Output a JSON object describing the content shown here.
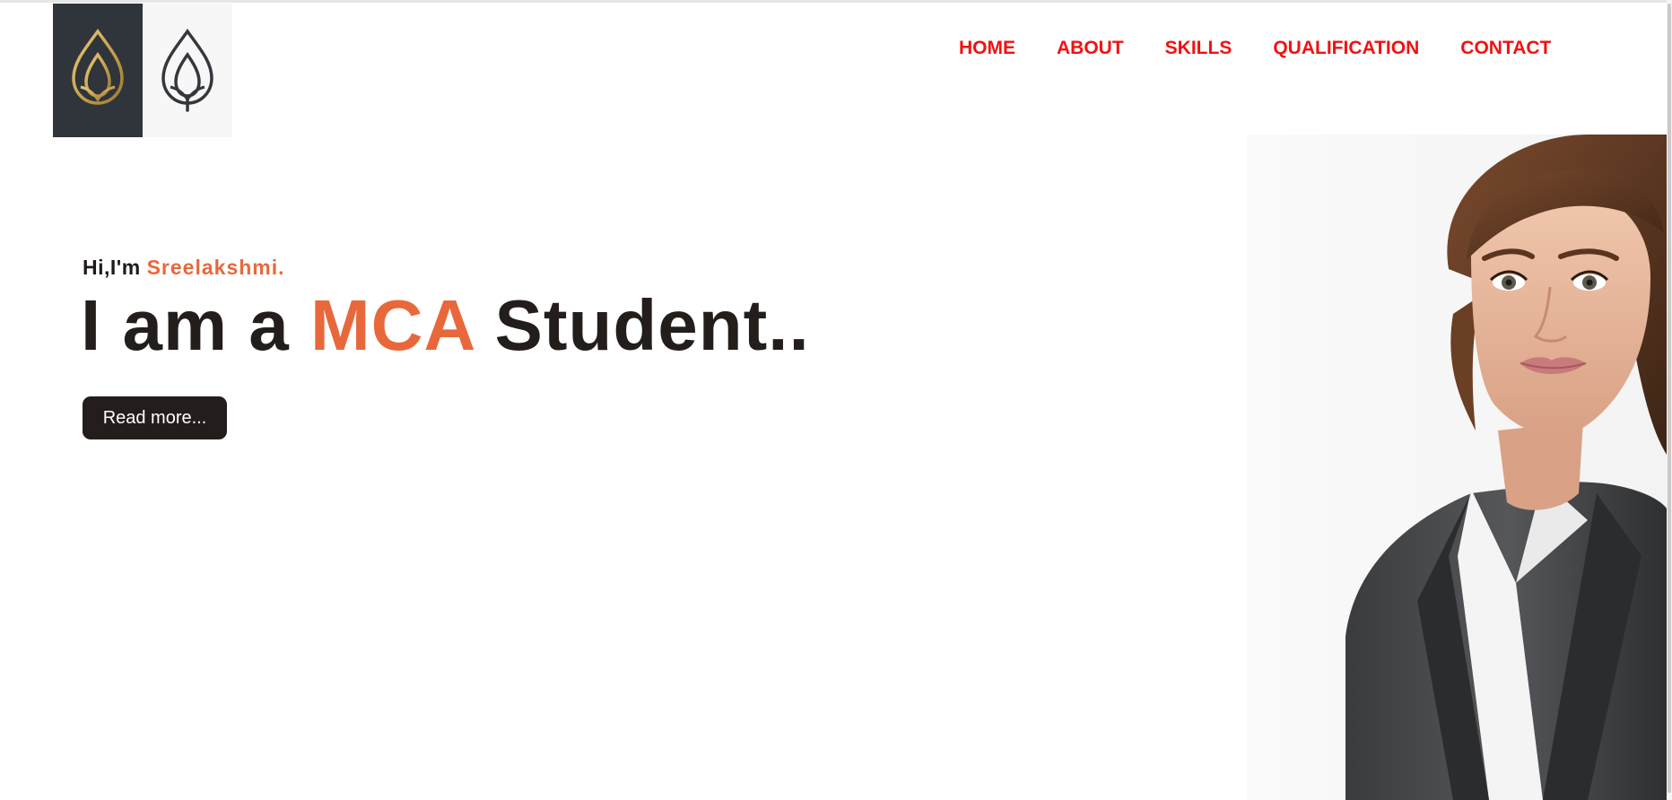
{
  "nav": {
    "items": [
      {
        "label": "HOME"
      },
      {
        "label": "ABOUT"
      },
      {
        "label": "SKILLS"
      },
      {
        "label": "QUALIFICATION"
      },
      {
        "label": "CONTACT"
      }
    ]
  },
  "hero": {
    "greeting_prefix": "Hi,I'm",
    "greeting_name": "Sreelakshmi.",
    "headline_prefix": "I am a",
    "headline_accent": "MCA",
    "headline_suffix": "Student..",
    "button_label": "Read more..."
  },
  "colors": {
    "nav_link": "#f21111",
    "accent": "#e8683c",
    "dark": "#231e1c",
    "logo_gold": "#c9a44f",
    "logo_dark_bg": "#30353b"
  },
  "icons": {
    "logo_left": "leaf-logo-gold-icon",
    "logo_right": "leaf-logo-dark-icon"
  }
}
